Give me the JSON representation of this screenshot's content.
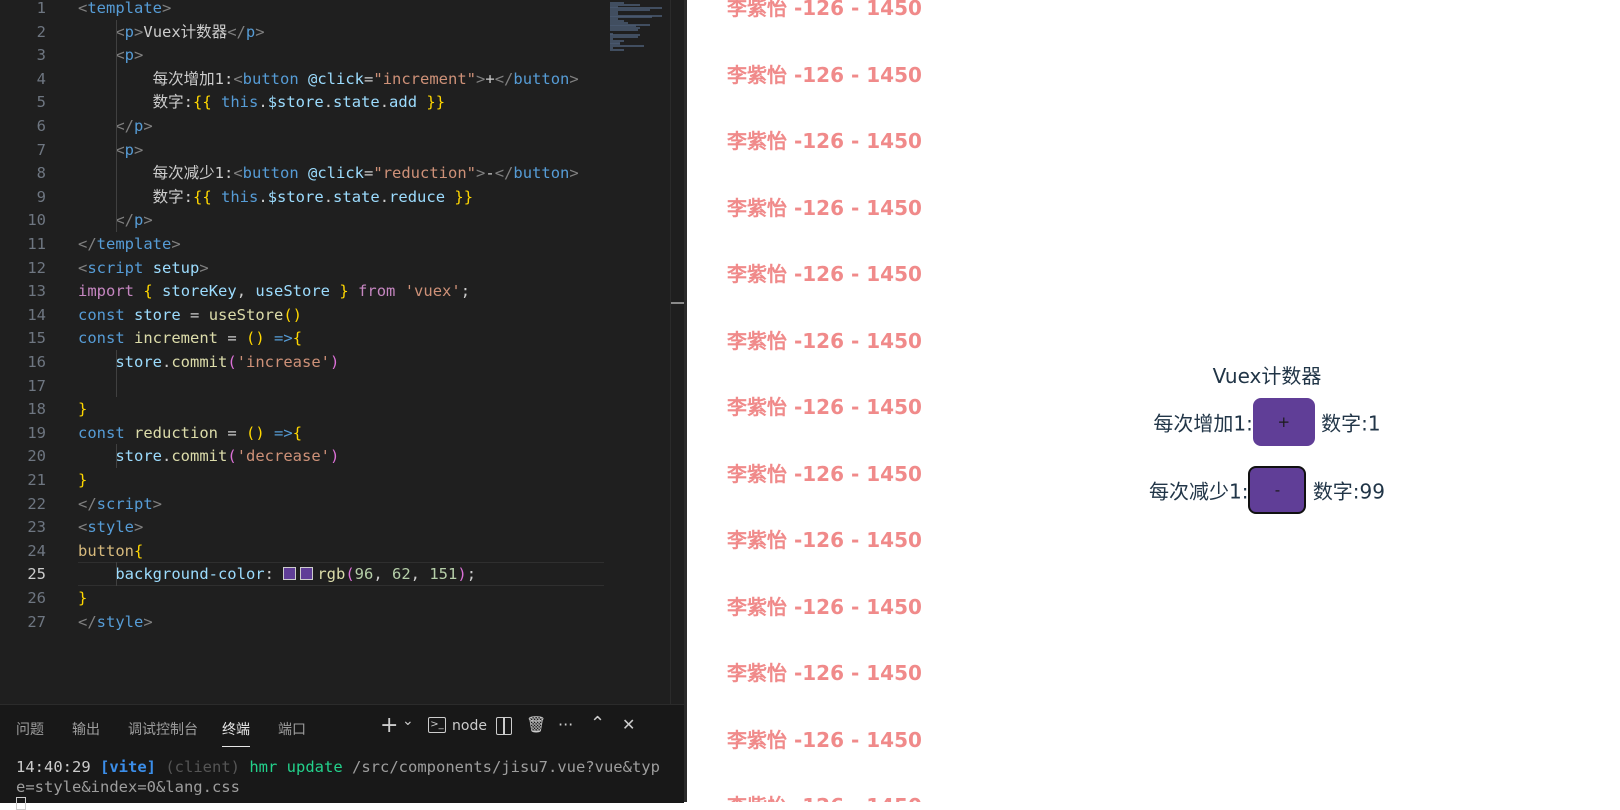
{
  "editor": {
    "lines": [
      {
        "n": "1",
        "tokens": [
          [
            "t-tag",
            "<"
          ],
          [
            "t-tagname",
            "template"
          ],
          [
            "t-tag",
            ">"
          ]
        ]
      },
      {
        "n": "2",
        "tokens": [
          [
            "t-plain",
            "    "
          ],
          [
            "t-tag",
            "<"
          ],
          [
            "t-tagname",
            "p"
          ],
          [
            "t-tag",
            ">"
          ],
          [
            "t-plain",
            "Vuex计数器"
          ],
          [
            "t-tag",
            "</"
          ],
          [
            "t-tagname",
            "p"
          ],
          [
            "t-tag",
            ">"
          ]
        ]
      },
      {
        "n": "3",
        "tokens": [
          [
            "t-plain",
            "    "
          ],
          [
            "t-tag",
            "<"
          ],
          [
            "t-tagname",
            "p"
          ],
          [
            "t-tag",
            ">"
          ]
        ]
      },
      {
        "n": "4",
        "tokens": [
          [
            "t-plain",
            "        每次增加1:"
          ],
          [
            "t-tag",
            "<"
          ],
          [
            "t-tagname",
            "button"
          ],
          [
            "t-plain",
            " "
          ],
          [
            "t-attr",
            "@click"
          ],
          [
            "t-plain",
            "="
          ],
          [
            "t-str",
            "\"increment\""
          ],
          [
            "t-tag",
            ">"
          ],
          [
            "t-plain",
            "+"
          ],
          [
            "t-tag",
            "</"
          ],
          [
            "t-tagname",
            "button"
          ],
          [
            "t-tag",
            ">"
          ]
        ]
      },
      {
        "n": "5",
        "tokens": [
          [
            "t-plain",
            "        数字:"
          ],
          [
            "t-brace",
            "{{"
          ],
          [
            "t-plain",
            " "
          ],
          [
            "t-this",
            "this"
          ],
          [
            "t-plain",
            "."
          ],
          [
            "t-var",
            "$store"
          ],
          [
            "t-plain",
            "."
          ],
          [
            "t-var",
            "state"
          ],
          [
            "t-plain",
            "."
          ],
          [
            "t-var",
            "add"
          ],
          [
            "t-plain",
            " "
          ],
          [
            "t-brace",
            "}}"
          ]
        ]
      },
      {
        "n": "6",
        "tokens": [
          [
            "t-plain",
            "    "
          ],
          [
            "t-tag",
            "</"
          ],
          [
            "t-tagname",
            "p"
          ],
          [
            "t-tag",
            ">"
          ]
        ]
      },
      {
        "n": "7",
        "tokens": [
          [
            "t-plain",
            "    "
          ],
          [
            "t-tag",
            "<"
          ],
          [
            "t-tagname",
            "p"
          ],
          [
            "t-tag",
            ">"
          ]
        ]
      },
      {
        "n": "8",
        "tokens": [
          [
            "t-plain",
            "        每次减少1:"
          ],
          [
            "t-tag",
            "<"
          ],
          [
            "t-tagname",
            "button"
          ],
          [
            "t-plain",
            " "
          ],
          [
            "t-attr",
            "@click"
          ],
          [
            "t-plain",
            "="
          ],
          [
            "t-str",
            "\"reduction\""
          ],
          [
            "t-tag",
            ">"
          ],
          [
            "t-plain",
            "-"
          ],
          [
            "t-tag",
            "</"
          ],
          [
            "t-tagname",
            "button"
          ],
          [
            "t-tag",
            ">"
          ]
        ]
      },
      {
        "n": "9",
        "tokens": [
          [
            "t-plain",
            "        数字:"
          ],
          [
            "t-brace",
            "{{"
          ],
          [
            "t-plain",
            " "
          ],
          [
            "t-this",
            "this"
          ],
          [
            "t-plain",
            "."
          ],
          [
            "t-var",
            "$store"
          ],
          [
            "t-plain",
            "."
          ],
          [
            "t-var",
            "state"
          ],
          [
            "t-plain",
            "."
          ],
          [
            "t-var",
            "reduce"
          ],
          [
            "t-plain",
            " "
          ],
          [
            "t-brace",
            "}}"
          ]
        ]
      },
      {
        "n": "10",
        "tokens": [
          [
            "t-plain",
            "    "
          ],
          [
            "t-tag",
            "</"
          ],
          [
            "t-tagname",
            "p"
          ],
          [
            "t-tag",
            ">"
          ]
        ]
      },
      {
        "n": "11",
        "tokens": [
          [
            "t-tag",
            "</"
          ],
          [
            "t-tagname",
            "template"
          ],
          [
            "t-tag",
            ">"
          ]
        ]
      },
      {
        "n": "12",
        "tokens": [
          [
            "t-tag",
            "<"
          ],
          [
            "t-tagname",
            "script"
          ],
          [
            "t-plain",
            " "
          ],
          [
            "t-attr",
            "setup"
          ],
          [
            "t-tag",
            ">"
          ]
        ]
      },
      {
        "n": "13",
        "tokens": [
          [
            "t-kw",
            "import"
          ],
          [
            "t-plain",
            " "
          ],
          [
            "t-brace",
            "{"
          ],
          [
            "t-plain",
            " "
          ],
          [
            "t-var",
            "storeKey"
          ],
          [
            "t-plain",
            ", "
          ],
          [
            "t-var",
            "useStore"
          ],
          [
            "t-plain",
            " "
          ],
          [
            "t-brace",
            "}"
          ],
          [
            "t-plain",
            " "
          ],
          [
            "t-kw",
            "from"
          ],
          [
            "t-plain",
            " "
          ],
          [
            "t-str",
            "'vuex'"
          ],
          [
            "t-plain",
            ";"
          ]
        ]
      },
      {
        "n": "14",
        "tokens": [
          [
            "t-decl",
            "const"
          ],
          [
            "t-plain",
            " "
          ],
          [
            "t-var",
            "store"
          ],
          [
            "t-plain",
            " = "
          ],
          [
            "t-fn",
            "useStore"
          ],
          [
            "t-brace",
            "()"
          ]
        ]
      },
      {
        "n": "15",
        "tokens": [
          [
            "t-decl",
            "const"
          ],
          [
            "t-plain",
            " "
          ],
          [
            "t-fn",
            "increment"
          ],
          [
            "t-plain",
            " = "
          ],
          [
            "t-brace",
            "()"
          ],
          [
            "t-plain",
            " "
          ],
          [
            "t-decl",
            "=>"
          ],
          [
            "t-brace",
            "{"
          ]
        ]
      },
      {
        "n": "16",
        "tokens": [
          [
            "t-plain",
            "    "
          ],
          [
            "t-var",
            "store"
          ],
          [
            "t-plain",
            "."
          ],
          [
            "t-fn",
            "commit"
          ],
          [
            "t-paren",
            "("
          ],
          [
            "t-str",
            "'increase'"
          ],
          [
            "t-paren",
            ")"
          ]
        ]
      },
      {
        "n": "17",
        "tokens": []
      },
      {
        "n": "18",
        "tokens": [
          [
            "t-brace",
            "}"
          ]
        ]
      },
      {
        "n": "19",
        "tokens": [
          [
            "t-decl",
            "const"
          ],
          [
            "t-plain",
            " "
          ],
          [
            "t-fn",
            "reduction"
          ],
          [
            "t-plain",
            " = "
          ],
          [
            "t-brace",
            "()"
          ],
          [
            "t-plain",
            " "
          ],
          [
            "t-decl",
            "=>"
          ],
          [
            "t-brace",
            "{"
          ]
        ]
      },
      {
        "n": "20",
        "tokens": [
          [
            "t-plain",
            "    "
          ],
          [
            "t-var",
            "store"
          ],
          [
            "t-plain",
            "."
          ],
          [
            "t-fn",
            "commit"
          ],
          [
            "t-paren",
            "("
          ],
          [
            "t-str",
            "'decrease'"
          ],
          [
            "t-paren",
            ")"
          ]
        ]
      },
      {
        "n": "21",
        "tokens": [
          [
            "t-brace",
            "}"
          ]
        ]
      },
      {
        "n": "22",
        "tokens": [
          [
            "t-tag",
            "</"
          ],
          [
            "t-tagname",
            "script"
          ],
          [
            "t-tag",
            ">"
          ]
        ]
      },
      {
        "n": "23",
        "tokens": [
          [
            "t-tag",
            "<"
          ],
          [
            "t-tagname",
            "style"
          ],
          [
            "t-tag",
            ">"
          ]
        ]
      },
      {
        "n": "24",
        "tokens": [
          [
            "t-sel",
            "button"
          ],
          [
            "t-brace",
            "{"
          ]
        ]
      },
      {
        "n": "25",
        "tokens": [
          [
            "t-plain",
            "    "
          ],
          [
            "t-prop",
            "background-color"
          ],
          [
            "t-plain",
            ": "
          ],
          [
            "swatch",
            ""
          ],
          [
            "swatch",
            ""
          ],
          [
            "t-fn",
            "rgb"
          ],
          [
            "t-paren",
            "("
          ],
          [
            "t-num",
            "96"
          ],
          [
            "t-plain",
            ", "
          ],
          [
            "t-num",
            "62"
          ],
          [
            "t-plain",
            ", "
          ],
          [
            "t-num",
            "151"
          ],
          [
            "t-paren",
            ")"
          ],
          [
            "t-plain",
            ";"
          ]
        ]
      },
      {
        "n": "26",
        "tokens": [
          [
            "t-brace",
            "}"
          ]
        ]
      },
      {
        "n": "27",
        "tokens": [
          [
            "t-tag",
            "</"
          ],
          [
            "t-tagname",
            "style"
          ],
          [
            "t-tag",
            ">"
          ]
        ]
      }
    ],
    "active_line": "25"
  },
  "panel": {
    "tabs": [
      "问题",
      "输出",
      "调试控制台",
      "终端",
      "端口"
    ],
    "active_tab": "终端",
    "tools": {
      "add": "+",
      "dropdown": "⌄",
      "terminal_name": "node",
      "split": "▯",
      "trash": "🗑",
      "more": "···",
      "maximize": "⌃",
      "close": "✕"
    },
    "terminal": {
      "time": "14:40:29",
      "vite": "[vite]",
      "client": "(client)",
      "hmr": "hmr update",
      "path": "/src/components/jisu7.vue?vue&type=style&index=0&lang.css"
    }
  },
  "preview": {
    "watermark": "李紫怡 -126 - 1450",
    "title": "Vuex计数器",
    "row1_label": "每次增加1:",
    "row1_button": "+",
    "row1_value": "数字:1",
    "row2_label": "每次减少1:",
    "row2_button": "-",
    "row2_value": "数字:99"
  },
  "colors": {
    "button_bg": "#603e97",
    "watermark": "#f08a8a",
    "editor_bg": "#1f1f1f"
  }
}
